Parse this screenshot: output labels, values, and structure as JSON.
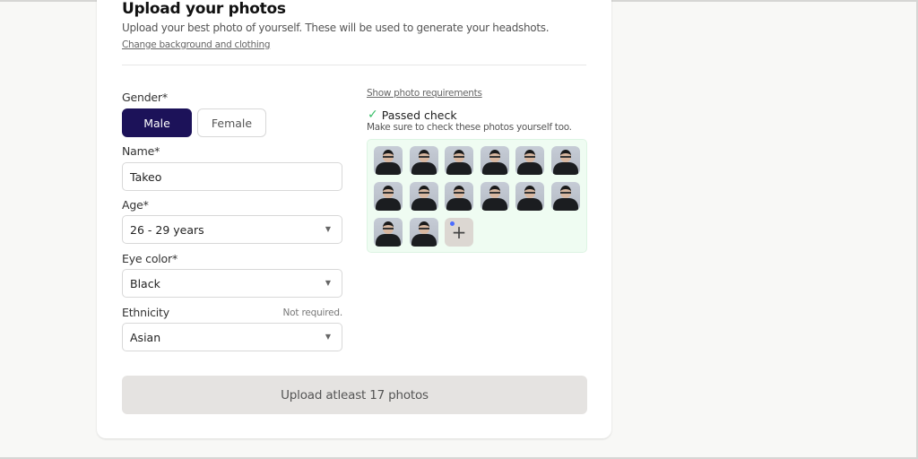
{
  "header": {
    "title": "Upload your photos",
    "subtitle": "Upload your best photo of yourself. These will be used to generate your headshots.",
    "change_link": "Change background and clothing"
  },
  "form": {
    "gender": {
      "label": "Gender*",
      "options": [
        "Male",
        "Female"
      ],
      "selected": "Male"
    },
    "name": {
      "label": "Name*",
      "value": "Takeo"
    },
    "age": {
      "label": "Age*",
      "value": "26 - 29 years"
    },
    "eye_color": {
      "label": "Eye color*",
      "value": "Black"
    },
    "ethnicity": {
      "label": "Ethnicity",
      "hint": "Not required.",
      "value": "Asian"
    }
  },
  "photos": {
    "requirements_link": "Show photo requirements",
    "status": "Passed check",
    "note": "Make sure to check these photos yourself too.",
    "count": 14,
    "add_label": "+"
  },
  "submit": {
    "label": "Upload atleast 17 photos"
  },
  "colors": {
    "primary": "#1c1259",
    "success": "#3bbf6a",
    "grid_bg": "#effcf2"
  }
}
